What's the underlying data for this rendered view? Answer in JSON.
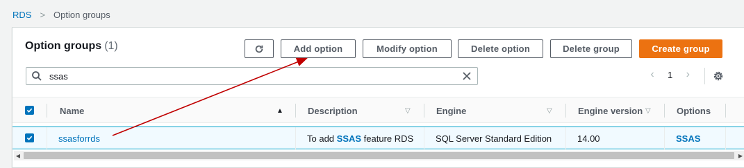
{
  "breadcrumb": {
    "root": "RDS",
    "separator": ">",
    "current": "Option groups"
  },
  "header": {
    "title": "Option groups",
    "count": "(1)"
  },
  "toolbar": {
    "refresh_icon": "refresh-icon",
    "add_option": "Add option",
    "modify_option": "Modify option",
    "delete_option": "Delete option",
    "delete_group": "Delete group",
    "create_group": "Create group",
    "primary_color": "#ec7211"
  },
  "search": {
    "value": "ssas",
    "icon": "search-icon",
    "clear_icon": "close-icon"
  },
  "pagination": {
    "prev": "‹",
    "page": "1",
    "next": "›"
  },
  "table": {
    "columns": [
      "Name",
      "Description",
      "Engine",
      "Engine version",
      "Options"
    ],
    "rows": [
      {
        "selected": true,
        "name": "ssasforrds",
        "description_prefix": "To add ",
        "description_highlight": "SSAS",
        "description_suffix": " feature RDS",
        "engine": "SQL Server Standard Edition",
        "engine_version": "14.00",
        "options": "SSAS"
      }
    ]
  },
  "annotation": {
    "type": "arrow",
    "color": "#c00000"
  }
}
